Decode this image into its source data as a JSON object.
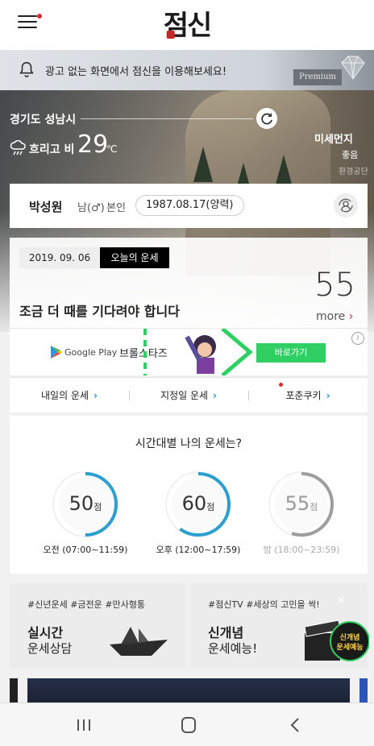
{
  "header": {
    "logo": "점신"
  },
  "banner": {
    "text": "광고 없는 화면에서 점신을 이용해보세요!",
    "premium": "Premium"
  },
  "weather": {
    "location": "경기도 성남시",
    "condition": "흐리고 비",
    "temperature": "29",
    "unit": "℃",
    "dust_label": "미세먼지",
    "dust_value": "좋음",
    "dust_sub": "환경공단"
  },
  "profile": {
    "name": "박성원",
    "gender": "남(♂)",
    "relation": "본인",
    "birth": "1987.08.17(양력)"
  },
  "fortune": {
    "date": "2019. 09. 06",
    "tab": "오늘의 운세",
    "score": "55",
    "message": "조금 더 때를 기다려야 합니다",
    "more": "more"
  },
  "ad": {
    "store": "Google Play",
    "title": "브롤스타즈",
    "button": "바로가기",
    "info": "i"
  },
  "quick_links": [
    {
      "label": "내일의 운세"
    },
    {
      "label": "지정일 운세"
    },
    {
      "label": "포춘쿠키"
    }
  ],
  "time_fortune": {
    "title": "시간대별 나의 운세는?",
    "unit": "점",
    "slots": [
      {
        "score": "50",
        "label": "오전 (07:00~11:59)",
        "progress": 0.5
      },
      {
        "score": "60",
        "label": "오후 (12:00~17:59)",
        "progress": 0.6
      },
      {
        "score": "55",
        "label": "밤 (18:00~23:59)",
        "progress": 0.55
      }
    ]
  },
  "promos": [
    {
      "tags": "#신년운세 #금전운 #만사형통",
      "title": "실시간",
      "subtitle": "운세상담"
    },
    {
      "tags": "#점신TV #세상의 고민을 싹!",
      "title": "신개념",
      "subtitle": "운세예능!",
      "badge": "신개념\n운세예능"
    }
  ],
  "colors": {
    "accent_blue": "#2a9fd0",
    "green": "#2fcf63",
    "red": "#d32f2f"
  }
}
